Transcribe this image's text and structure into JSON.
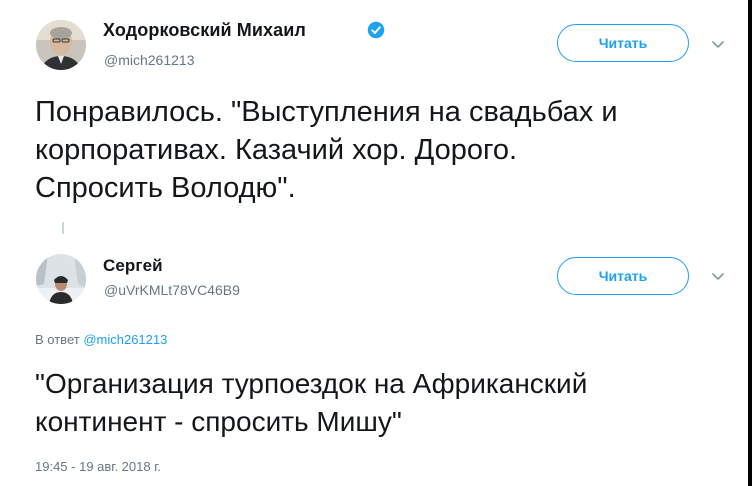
{
  "tweet1": {
    "author_name": "Ходорковский Михаил",
    "author_handle": "@mich261213",
    "follow_label": "Читать",
    "text_lines": [
      "Понравилось. \"Выступления на свадьбах и",
      "корпоративах. Казачий хор. Дорого.",
      "Спросить Володю\"."
    ],
    "icons": {
      "verified": "verified-badge-icon",
      "menu": "chevron-down-icon"
    }
  },
  "tweet2": {
    "author_name": "Сергей",
    "author_handle": "@uVrKMLt78VC46B9",
    "follow_label": "Читать",
    "reply_prefix": "В ответ",
    "reply_handle": "@mich261213",
    "text_lines": [
      "\"Организация турпоездок на Африканский",
      "континент - спросить Мишу\""
    ],
    "timestamp": "19:45 - 19 авг. 2018 г.",
    "icons": {
      "menu": "chevron-down-icon"
    }
  },
  "colors": {
    "accent": "#1da1f2",
    "text": "#14171a",
    "muted": "#657786"
  }
}
